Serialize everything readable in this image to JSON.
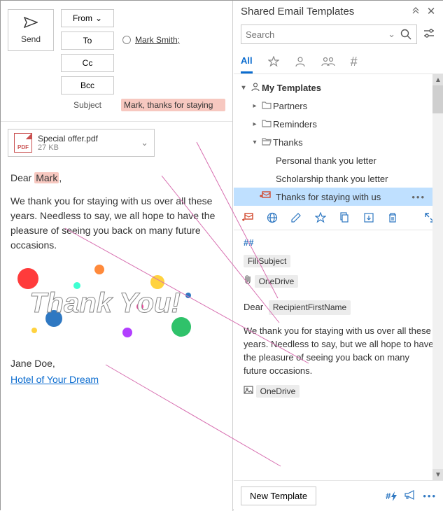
{
  "compose": {
    "send_label": "Send",
    "from_label": "From",
    "to_label": "To",
    "cc_label": "Cc",
    "bcc_label": "Bcc",
    "subject_label": "Subject",
    "to_value": "Mark Smith;",
    "subject_value": "Mark, thanks for staying"
  },
  "attachment": {
    "name": "Special offer.pdf",
    "size": "27 KB"
  },
  "body": {
    "greeting_prefix": "Dear ",
    "greeting_name": "Mark",
    "greeting_suffix": ",",
    "paragraph": "We thank you for staying with us over all these years. Needless to say, we all hope to have the pleasure of seeing you back on many future occasions.",
    "thankyou_text": "Thank You!",
    "signoff": "Jane Doe,",
    "link": "Hotel of Your Dream"
  },
  "panel": {
    "title": "Shared Email Templates",
    "search_placeholder": "Search",
    "filter_all": "All",
    "tree": {
      "root": "My Templates",
      "partners": "Partners",
      "reminders": "Reminders",
      "thanks": "Thanks",
      "item1": "Personal thank you letter",
      "item2": "Scholarship thank you letter",
      "item3": "Thanks for staying with us"
    },
    "preview": {
      "hash": "##",
      "fillsubject": "FillSubject",
      "onedrive1": "OneDrive",
      "dear": "Dear",
      "recipient_macro": "RecipientFirstName",
      "paragraph": "We thank you for staying with us over all these years. Needless  to say, but we all hope to have the pleasure of seeing you back on many future occasions.",
      "onedrive2": "OneDrive"
    },
    "new_template": "New Template",
    "footer_hash": "#"
  }
}
